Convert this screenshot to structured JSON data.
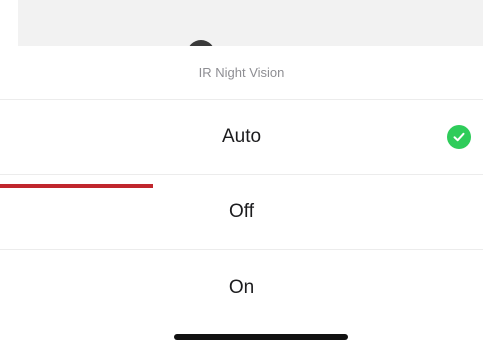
{
  "sheet": {
    "title": "IR Night Vision",
    "options": [
      {
        "label": "Auto",
        "selected": true
      },
      {
        "label": "Off",
        "selected": false
      },
      {
        "label": "On",
        "selected": false
      }
    ]
  },
  "colors": {
    "check": "#2ecc5a",
    "annotation": "#c0262d",
    "title_text": "#8e8e93",
    "option_text": "#1c1c1e"
  },
  "icons": {
    "selected": "checkmark-circle-icon"
  }
}
